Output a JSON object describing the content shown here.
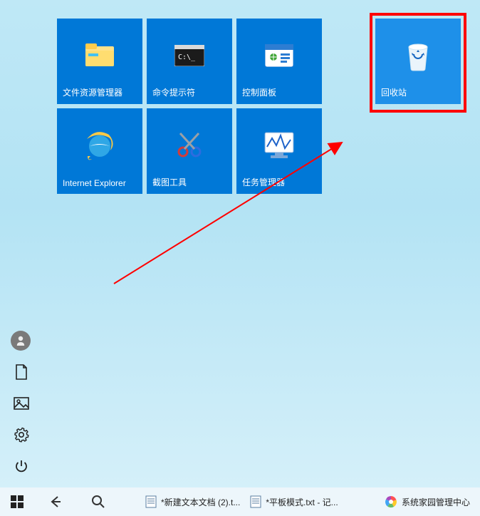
{
  "tiles": {
    "file_explorer": {
      "label": "文件资源管理器"
    },
    "cmd": {
      "label": "命令提示符"
    },
    "control_panel": {
      "label": "控制面板"
    },
    "ie": {
      "label": "Internet Explorer"
    },
    "snipping_tool": {
      "label": "截图工具"
    },
    "task_manager": {
      "label": "任务管理器"
    },
    "recycle_bin": {
      "label": "回收站"
    }
  },
  "taskbar": {
    "task1": {
      "label": "*新建文本文档 (2).t..."
    },
    "task2": {
      "label": "*平板模式.txt - 记..."
    },
    "tray": {
      "label": "系统家园管理中心"
    }
  }
}
